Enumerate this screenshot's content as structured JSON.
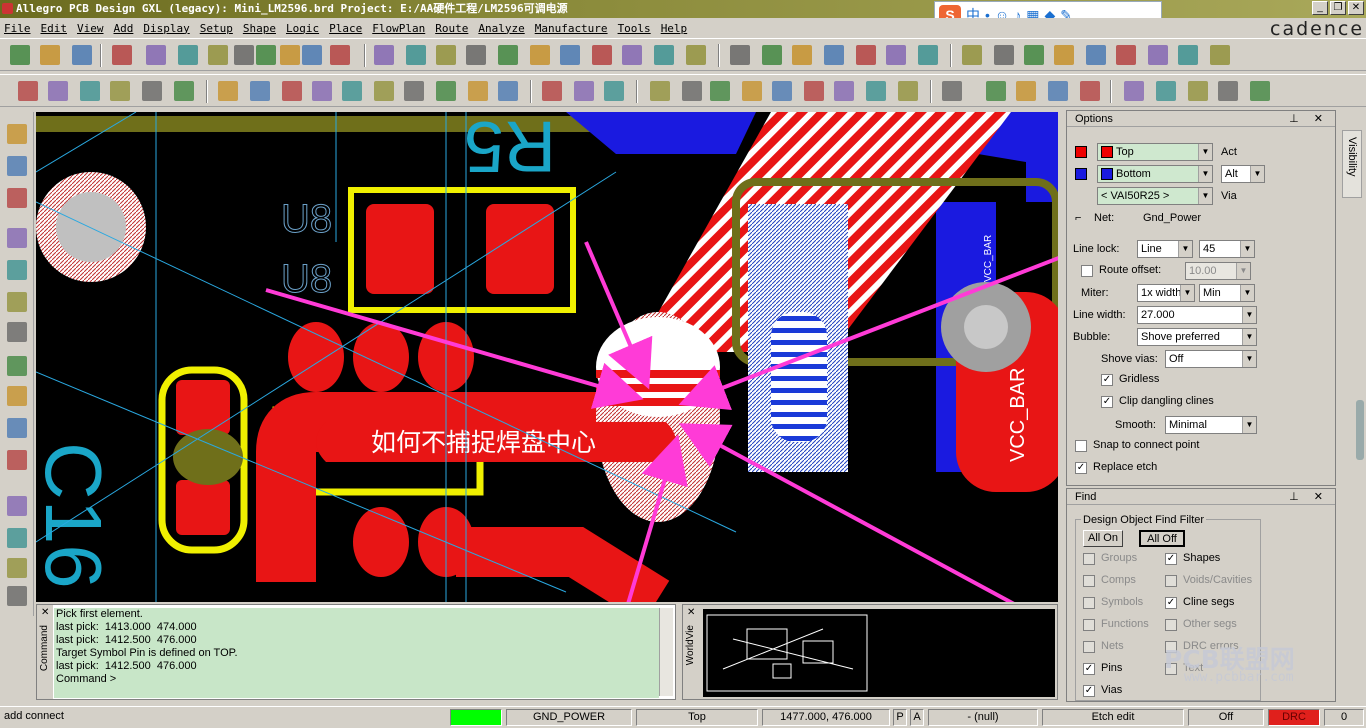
{
  "titlebar": {
    "text": "Allegro PCB Design GXL (legacy): Mini_LM2596.brd  Project: E:/AA硬件工程/LM2596可调电源"
  },
  "ime": {
    "logo": "S",
    "mode": "中"
  },
  "window_buttons": {
    "minimize": "_",
    "restore": "❐",
    "close": "✕"
  },
  "brand": "cadence",
  "menubar": [
    "File",
    "Edit",
    "View",
    "Add",
    "Display",
    "Setup",
    "Shape",
    "Logic",
    "Place",
    "FlowPlan",
    "Route",
    "Analyze",
    "Manufacture",
    "Tools",
    "Help"
  ],
  "canvas": {
    "annotation_text": "如何不捕捉焊盘中心",
    "silkscreen_labels": [
      "U8",
      "U8",
      "R5",
      "C16",
      "VCC_BAR",
      "VCC_BAR"
    ]
  },
  "command_window": {
    "label": "Command",
    "lines": [
      "Pick first element.",
      "last pick:  1413.000  474.000",
      "last pick:  1412.500  476.000",
      "Target Symbol Pin is defined on TOP.",
      "last pick:  1412.500  476.000",
      "Command >"
    ]
  },
  "worldview": {
    "label": "WorldVie"
  },
  "options": {
    "title": "Options",
    "act_layer": "Top",
    "act_label": "Act",
    "alt_layer": "Bottom",
    "alt_label": "Alt",
    "via_value": "< VAI50R25 >",
    "via_label": "Via",
    "net_label": "Net:",
    "net_value": "Gnd_Power",
    "line_lock_label": "Line lock:",
    "line_lock_type": "Line",
    "line_lock_angle": "45",
    "route_offset_label": "Route offset:",
    "route_offset_value": "10.00",
    "miter_label": "Miter:",
    "miter_value": "1x width",
    "miter_mode": "Min",
    "line_width_label": "Line width:",
    "line_width_value": "27.000",
    "bubble_label": "Bubble:",
    "bubble_value": "Shove preferred",
    "shove_vias_label": "Shove vias:",
    "shove_vias_value": "Off",
    "gridless_label": "Gridless",
    "clip_label": "Clip dangling clines",
    "smooth_label": "Smooth:",
    "smooth_value": "Minimal",
    "snap_label": "Snap to connect point",
    "replace_label": "Replace etch",
    "visibility_tab": "Visibility"
  },
  "find": {
    "title": "Find",
    "group_label": "Design Object Find Filter",
    "all_on": "All On",
    "all_off": "All Off",
    "items_left": [
      {
        "label": "Groups",
        "checked": false,
        "enabled": false
      },
      {
        "label": "Comps",
        "checked": false,
        "enabled": false
      },
      {
        "label": "Symbols",
        "checked": false,
        "enabled": false
      },
      {
        "label": "Functions",
        "checked": false,
        "enabled": false
      },
      {
        "label": "Nets",
        "checked": false,
        "enabled": false
      },
      {
        "label": "Pins",
        "checked": true,
        "enabled": true
      },
      {
        "label": "Vias",
        "checked": true,
        "enabled": true
      }
    ],
    "items_right": [
      {
        "label": "Shapes",
        "checked": true,
        "enabled": true
      },
      {
        "label": "Voids/Cavities",
        "checked": false,
        "enabled": false
      },
      {
        "label": "Cline segs",
        "checked": true,
        "enabled": true
      },
      {
        "label": "Other segs",
        "checked": false,
        "enabled": false
      },
      {
        "label": "DRC errors",
        "checked": false,
        "enabled": false
      },
      {
        "label": "Text",
        "checked": false,
        "enabled": false
      }
    ]
  },
  "watermark": {
    "line1": "PCB联盟网",
    "line2": "www.pcbbar.com"
  },
  "statusbar": {
    "command": "add connect",
    "net": "GND_POWER",
    "layer": "Top",
    "coords": "1477.000, 476.000",
    "p": "P",
    "a": "A",
    "selection": "- (null)",
    "mode": "Etch edit",
    "off": "Off",
    "drc": "DRC",
    "count": "0"
  },
  "colors": {
    "status_green": "#00ff00",
    "drc_red": "#e0201c",
    "arrow_magenta": "#ff3bd7",
    "etch_red": "#e81515",
    "silk_yellow": "#f0f000",
    "silk_cyan": "#1aa6c8"
  }
}
